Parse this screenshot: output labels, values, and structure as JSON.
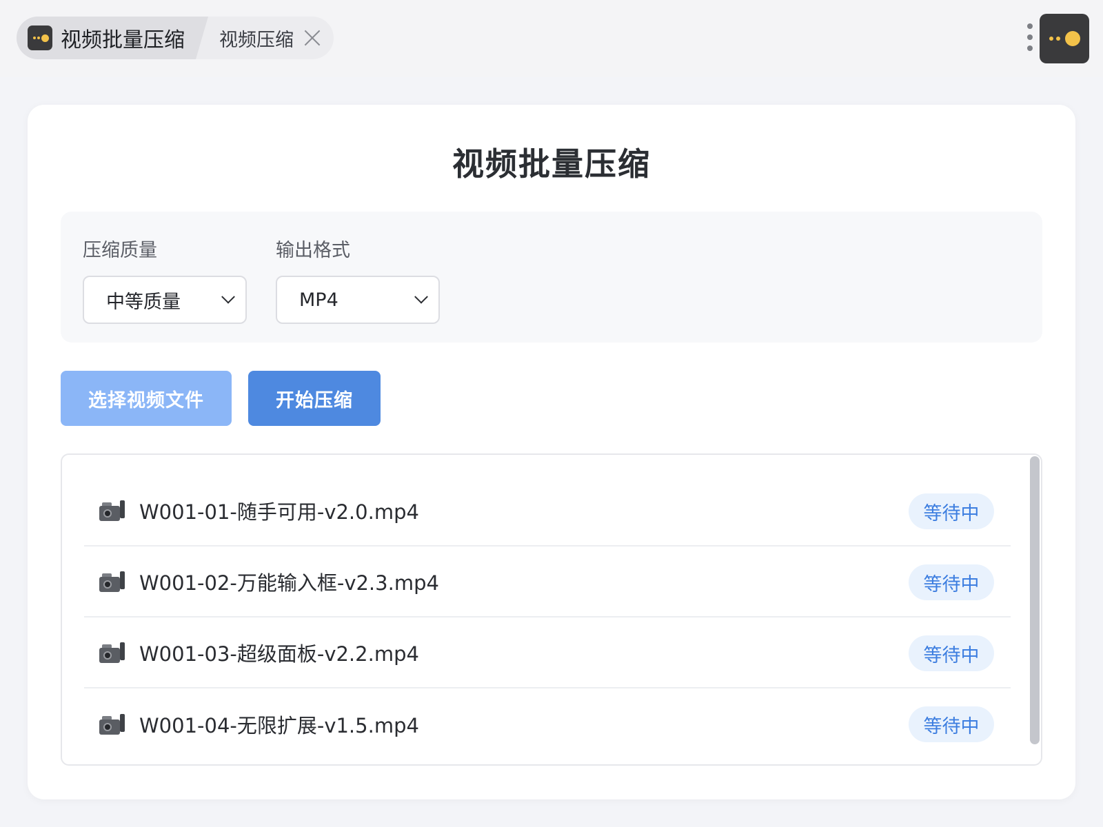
{
  "tabs": [
    {
      "label": "视频批量压缩",
      "active": true,
      "icon": "app-logo-icon"
    },
    {
      "label": "视频压缩",
      "active": false,
      "icon": "close-icon"
    }
  ],
  "header": {
    "menu_icon": "more-vertical-icon",
    "logo_icon": "app-logo-icon"
  },
  "main": {
    "title": "视频批量压缩",
    "settings": {
      "quality": {
        "label": "压缩质量",
        "value": "中等质量"
      },
      "format": {
        "label": "输出格式",
        "value": "MP4"
      }
    },
    "buttons": {
      "select_files": "选择视频文件",
      "start": "开始压缩"
    },
    "files": [
      {
        "name": "W001-01-随手可用-v2.0.mp4",
        "status": "等待中"
      },
      {
        "name": "W001-02-万能输入框-v2.3.mp4",
        "status": "等待中"
      },
      {
        "name": "W001-03-超级面板-v2.2.mp4",
        "status": "等待中"
      },
      {
        "name": "W001-04-无限扩展-v1.5.mp4",
        "status": "等待中"
      }
    ]
  },
  "colors": {
    "primary": "#4e89e0",
    "primary_light": "#8bb6f7",
    "badge_bg": "#e9f2fd",
    "badge_text": "#3d7ee0",
    "logo_accent": "#f3c24a"
  }
}
